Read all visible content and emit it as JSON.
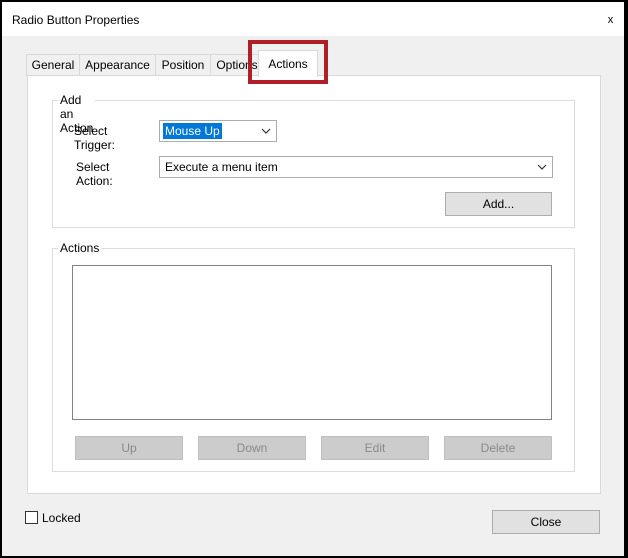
{
  "window": {
    "title": "Radio Button Properties",
    "close_glyph": "x"
  },
  "tabs": [
    {
      "label": "General",
      "active": false
    },
    {
      "label": "Appearance",
      "active": false
    },
    {
      "label": "Position",
      "active": false
    },
    {
      "label": "Options",
      "active": false
    },
    {
      "label": "Actions",
      "active": true
    }
  ],
  "add_action": {
    "group_label": "Add an Action",
    "trigger_label": "Select Trigger:",
    "trigger_value": "Mouse Up",
    "action_label": "Select Action:",
    "action_value": "Execute a menu item",
    "add_button": "Add..."
  },
  "actions": {
    "group_label": "Actions",
    "items": [],
    "buttons": {
      "up": "Up",
      "down": "Down",
      "edit": "Edit",
      "delete": "Delete"
    }
  },
  "footer": {
    "locked_label": "Locked",
    "locked_checked": false,
    "close_button": "Close"
  },
  "colors": {
    "highlight": "#b01e28",
    "selection": "#0078d7"
  }
}
